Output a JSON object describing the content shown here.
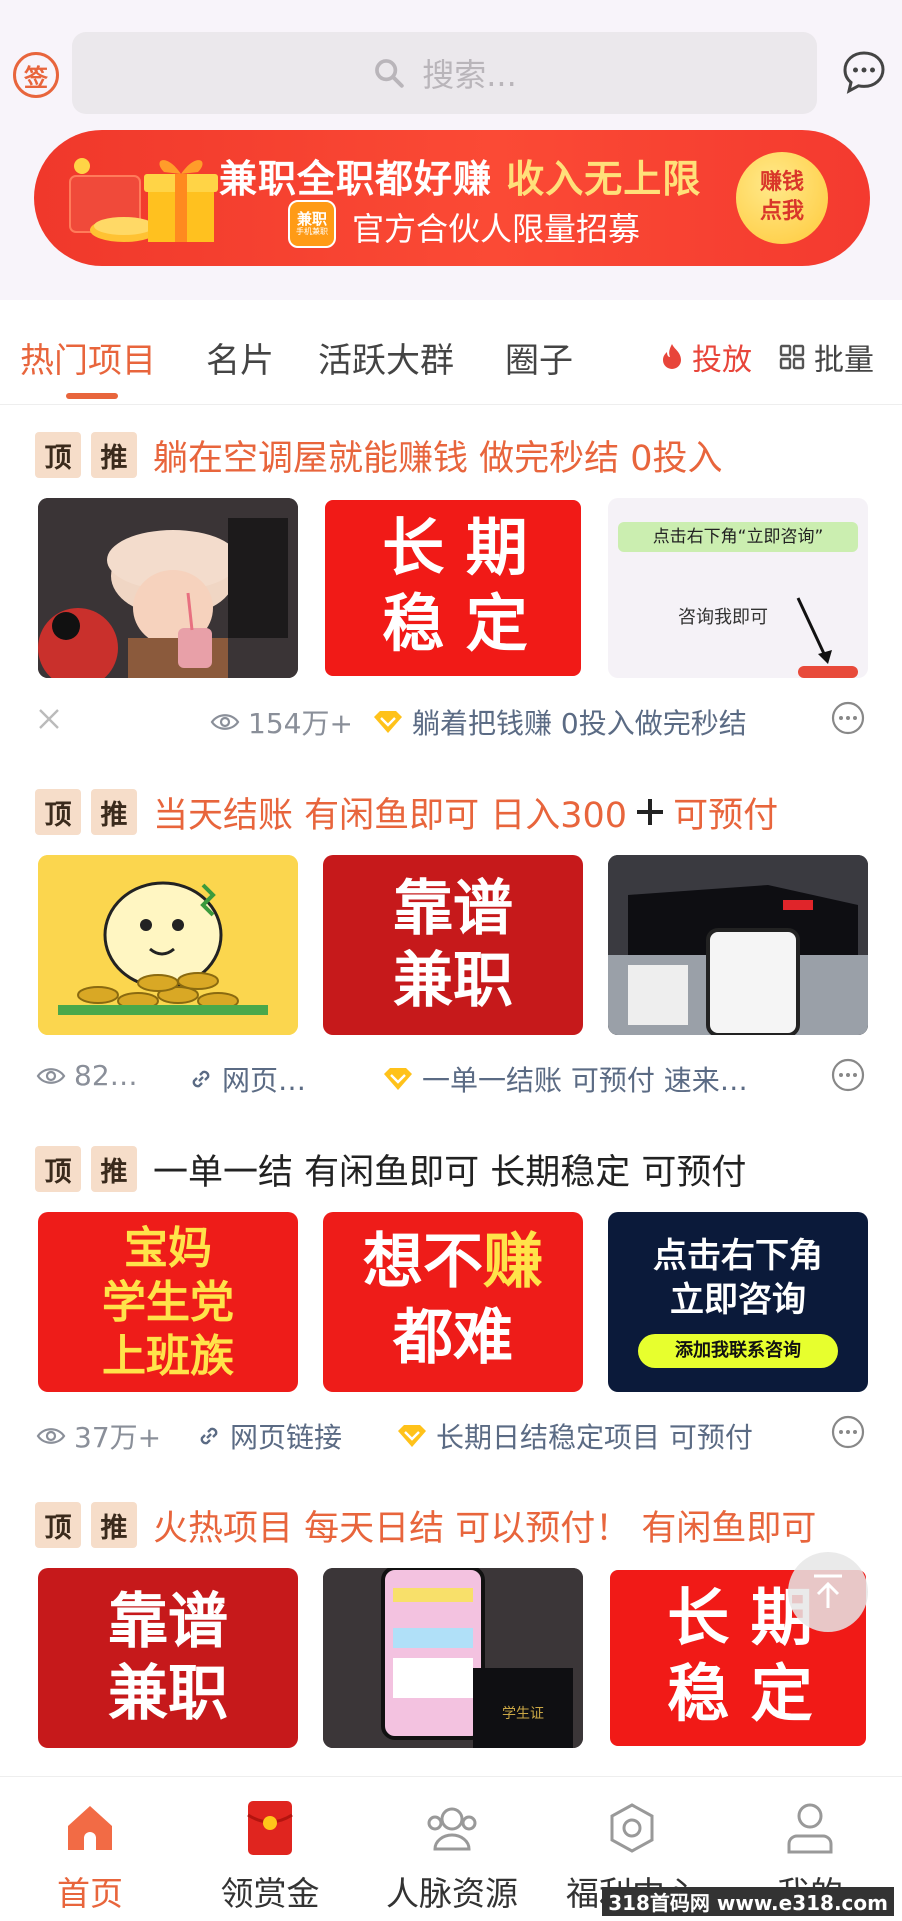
{
  "header": {
    "sign_label": "签",
    "search_placeholder": "搜索..."
  },
  "banner": {
    "title_part1": "兼职全职都好赚 ",
    "title_part2": "收入无上限",
    "logo_text": "兼职",
    "logo_sub": "手机兼职",
    "subtitle": "官方合伙人限量招募",
    "button_line1": "赚钱",
    "button_line2": "点我"
  },
  "tabs": [
    {
      "label": "热门项目",
      "active": true
    },
    {
      "label": "名片"
    },
    {
      "label": "活跃大群"
    },
    {
      "label": "圈子"
    }
  ],
  "tab_actions": {
    "promote": "投放",
    "batch": "批量"
  },
  "badges": {
    "top": "顶",
    "recommend": "推"
  },
  "posts": [
    {
      "title": "躺在空调屋就能赚钱 做完秒结 0投入",
      "title_color": "orange",
      "images": [
        {
          "kind": "photo-child",
          "text": ""
        },
        {
          "kind": "red-text",
          "line1": "长 期",
          "line2": "稳 定"
        },
        {
          "kind": "screenshot",
          "line1": "点击右下角“立即咨询”",
          "line2": "咨询我即可"
        }
      ],
      "views": "154万+",
      "desc": "躺着把钱赚 0投入做完秒结"
    },
    {
      "title": "当天结账 有闲鱼即可 日入300",
      "title_suffix": "可预付",
      "title_color": "orange",
      "images": [
        {
          "kind": "cartoon-coins"
        },
        {
          "kind": "red-text",
          "line1": "靠谱",
          "line2": "兼职"
        },
        {
          "kind": "photo-car-phone"
        }
      ],
      "views": "82…",
      "link": "网页…",
      "desc": "一单一结账 可预付 速来…"
    },
    {
      "title": "一单一结 有闲鱼即可 长期稳定 可预付",
      "title_color": "dark",
      "images": [
        {
          "kind": "red-yellow",
          "line1": "宝妈",
          "line2": "学生党",
          "line3": "上班族"
        },
        {
          "kind": "red-mixed",
          "line1a": "想不",
          "line1b": "赚",
          "line2": "都难"
        },
        {
          "kind": "dark-consult",
          "line1": "点击右下角",
          "line2": "立即咨询",
          "button": "添加我联系咨询"
        }
      ],
      "views": "37万+",
      "link": "网页链接",
      "desc": "长期日结稳定项目 可预付"
    },
    {
      "title": "火热项目 每天日结 可以预付！ 有闲鱼即可",
      "title_color": "orange",
      "images": [
        {
          "kind": "red-text",
          "line1": "靠谱",
          "line2": "兼职"
        },
        {
          "kind": "photo-phone-card"
        },
        {
          "kind": "red-text",
          "line1": "长 期",
          "line2": "稳 定"
        }
      ]
    }
  ],
  "bottom_nav": [
    {
      "label": "首页",
      "icon": "home-icon",
      "active": true
    },
    {
      "label": "领赏金",
      "icon": "red-envelope-icon"
    },
    {
      "label": "人脉资源",
      "icon": "people-icon"
    },
    {
      "label": "福利中心",
      "icon": "hexagon-icon"
    },
    {
      "label": "我的",
      "icon": "user-icon"
    }
  ],
  "watermark": "318首码网 www.e318.com",
  "colors": {
    "accent": "#e8653c",
    "banner_red": "#f0382b",
    "badge_bg": "#f6ddc9"
  }
}
